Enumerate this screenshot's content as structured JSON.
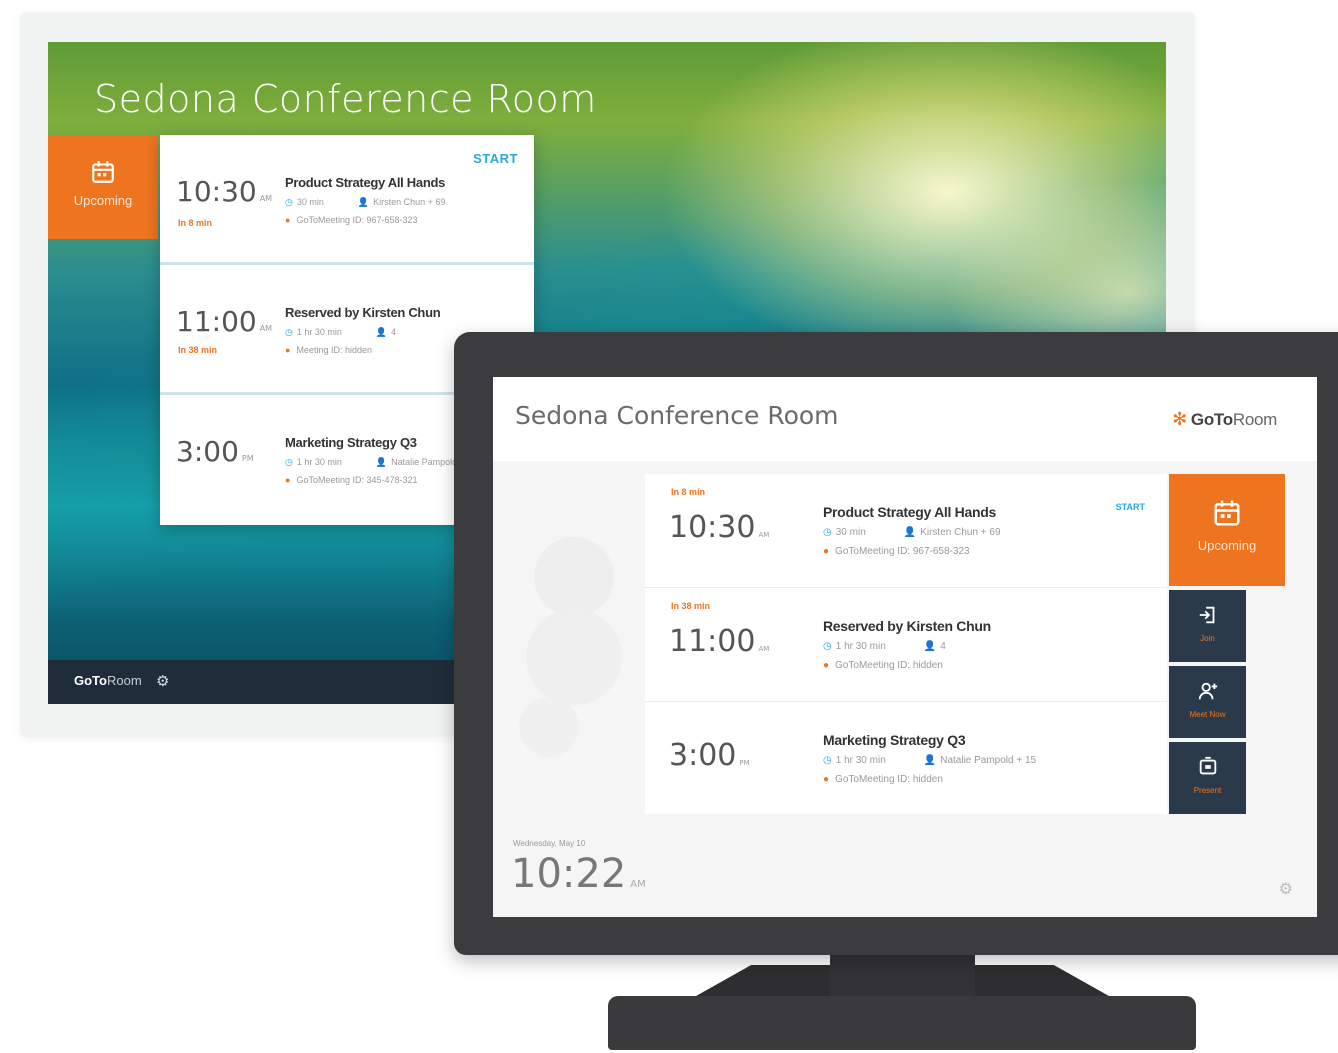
{
  "room_name": "Sedona Conference Room",
  "brand": {
    "prefix": "GoTo",
    "suffix": "Room"
  },
  "upcoming_label": "Upcoming",
  "start_label": "START",
  "meetings": [
    {
      "time": "10:30",
      "ampm": "AM",
      "relative": "In 8 min",
      "title": "Product Strategy All Hands",
      "duration": "30 min",
      "attendees": "Kirsten Chun + 69",
      "meeting_id": "GoToMeeting ID: 967-658-323"
    },
    {
      "time": "11:00",
      "ampm": "AM",
      "relative": "In 38 min",
      "title": "Reserved by Kirsten Chun",
      "duration": "1 hr 30 min",
      "attendees": "4",
      "meeting_id": "Meeting ID: hidden"
    },
    {
      "time": "3:00",
      "ampm": "PM",
      "relative": "",
      "title": "Marketing Strategy Q3",
      "duration": "1 hr 30 min",
      "attendees": "Natalie Pampold + 15",
      "meeting_id": "GoToMeeting ID: 345-478-321"
    }
  ],
  "tablet_meetings": [
    {
      "time": "10:30",
      "ampm": "AM",
      "relative": "In 8 min",
      "title": "Product Strategy All Hands",
      "duration": "30 min",
      "attendees": "Kirsten Chun + 69",
      "meeting_id": "GoToMeeting ID: 967-658-323"
    },
    {
      "time": "11:00",
      "ampm": "AM",
      "relative": "In 38 min",
      "title": "Reserved by Kirsten Chun",
      "duration": "1 hr 30 min",
      "attendees": "4",
      "meeting_id": "GoToMeeting ID: hidden"
    },
    {
      "time": "3:00",
      "ampm": "PM",
      "relative": "",
      "title": "Marketing Strategy Q3",
      "duration": "1 hr 30 min",
      "attendees": "Natalie Pampold + 15",
      "meeting_id": "GoToMeeting ID: hidden"
    }
  ],
  "actions": {
    "join": "Join",
    "meet_now": "Meet Now",
    "present": "Present"
  },
  "clock": {
    "date": "Wednesday, May 10",
    "time": "10:22",
    "ampm": "AM"
  },
  "colors": {
    "accent": "#ee7420",
    "link": "#27a8e0",
    "dark": "#2a3a4a"
  },
  "icons": {
    "calendar": "calendar-icon",
    "join": "join-icon",
    "meet_now": "add-person-icon",
    "present": "present-icon",
    "settings": "gear-icon"
  }
}
